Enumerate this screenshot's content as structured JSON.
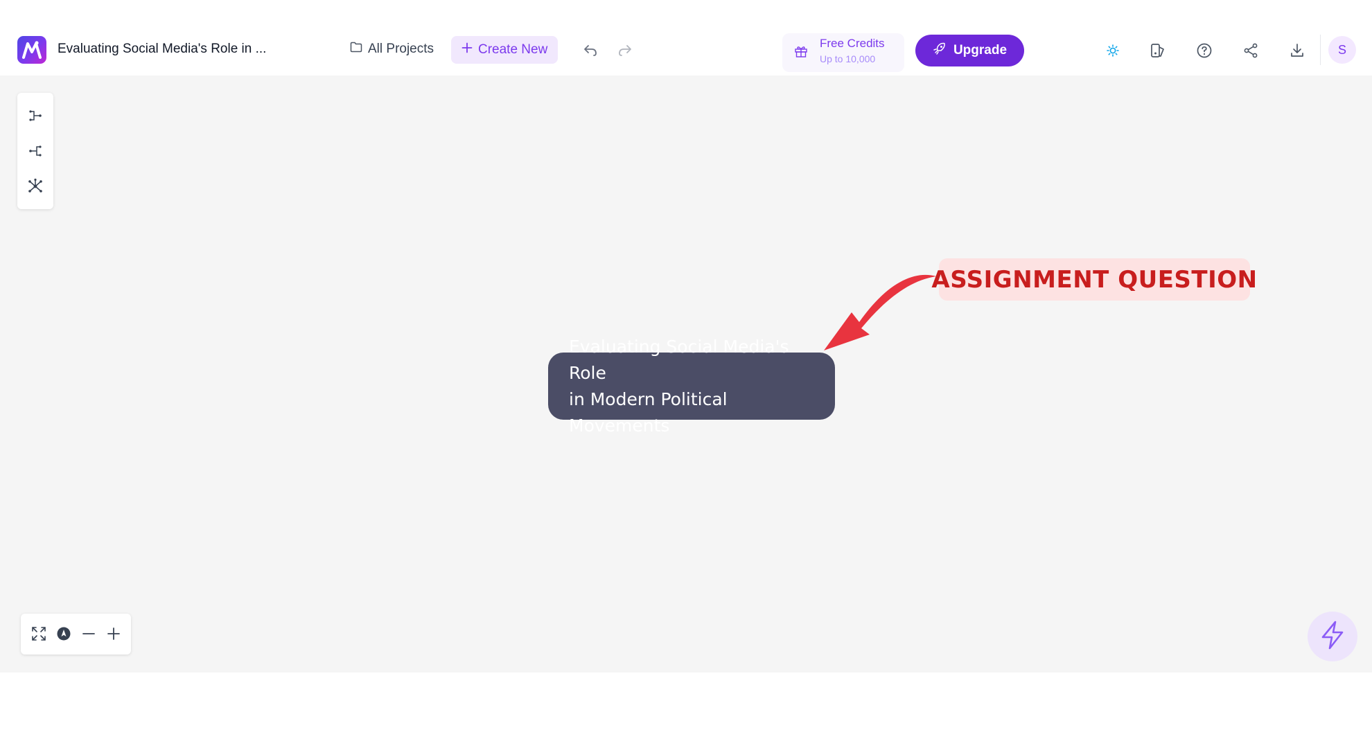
{
  "header": {
    "doc_title": "Evaluating Social Media's Role in ...",
    "all_projects_label": "All Projects",
    "create_new_label": "Create New",
    "credits_title": "Free Credits",
    "credits_sub": "Up to 10,000",
    "upgrade_label": "Upgrade",
    "avatar_initial": "S"
  },
  "canvas": {
    "root_node_line1": "Evaluating Social Media's Role",
    "root_node_line2": "in Modern Political Movements",
    "annotation_label": "ASSIGNMENT QUESTION"
  },
  "colors": {
    "accent": "#7c3aed",
    "upgrade_bg": "#6d28d9",
    "node_bg": "#4b4d66",
    "annotation_text": "#c81e1e",
    "annotation_bg": "#fde2e2",
    "arrow": "#e8343f",
    "canvas_bg": "#f5f5f5"
  },
  "icons": {
    "logo": "app-logo-icon",
    "folder": "folder-icon",
    "plus": "plus-icon",
    "undo": "undo-icon",
    "redo": "redo-icon",
    "gift": "gift-icon",
    "rocket": "rocket-icon",
    "theme": "sun-icon",
    "layout_style": "layout-style-icon",
    "help": "help-icon",
    "share": "share-icon",
    "download": "download-icon",
    "layout_right": "layout-right-icon",
    "layout_left": "layout-left-icon",
    "layout_radial": "layout-radial-icon",
    "fit_screen": "fit-screen-icon",
    "locate": "locate-icon",
    "zoom_out": "zoom-out-icon",
    "zoom_in": "zoom-in-icon",
    "ai_bolt": "bolt-icon"
  }
}
